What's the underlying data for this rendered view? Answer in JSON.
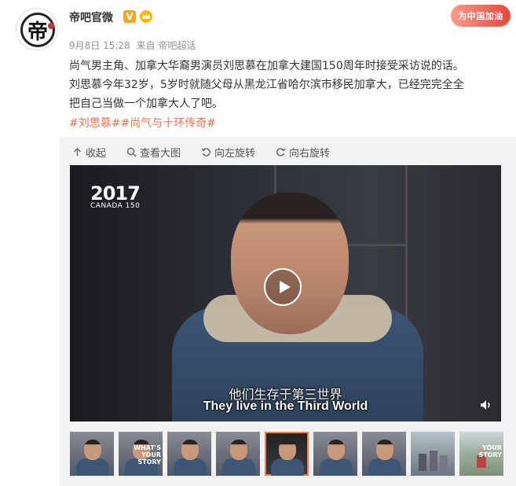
{
  "post": {
    "username": "帝吧官微",
    "avatar_char": "帝",
    "verified_badge": "V",
    "timestamp": "9月8日 15:28",
    "source_prefix": "来自",
    "source": "帝吧超话",
    "promo_badge": "为中国加油",
    "content_line1": "尚气男主角、加拿大华裔男演员刘思慕在加拿大建国150周年时接受采访说的话。",
    "content_line2": "刘思慕今年32岁，5岁时就随父母从黑龙江省哈尔滨市移民加拿大，已经完完全全",
    "content_line3": "把自己当做一个加拿大人了吧。",
    "tags": [
      "#刘思慕#",
      "#尚气与十环传奇#"
    ]
  },
  "toolbar": {
    "collapse": "收起",
    "view_large": "查看大图",
    "rotate_left": "向左旋转",
    "rotate_right": "向右旋转"
  },
  "video": {
    "logo_year": "2017",
    "logo_sub": "CANADA 150",
    "subtitle_cn": "他们生存于第三世界",
    "subtitle_en": "They live in the Third World"
  },
  "thumbnails": [
    {
      "kind": "person",
      "text": ""
    },
    {
      "kind": "person",
      "text": ""
    },
    {
      "kind": "person",
      "text": ""
    },
    {
      "kind": "person",
      "text": ""
    },
    {
      "kind": "person-active",
      "text": ""
    },
    {
      "kind": "person",
      "text": ""
    },
    {
      "kind": "person",
      "text": ""
    },
    {
      "kind": "person",
      "text": ""
    },
    {
      "kind": "scene",
      "text": ""
    },
    {
      "kind": "field",
      "text": "YOUR STORY"
    }
  ],
  "thumbnail_texts": [
    "WHAT'S YOUR STORY",
    "YOUR STORY"
  ],
  "colors": {
    "tag": "#eb7350",
    "active_thumb_border": "#f77e44",
    "verified": "#f5a623"
  },
  "icons": [
    "collapse-arrow-icon",
    "magnifier-icon",
    "rotate-left-icon",
    "rotate-right-icon",
    "play-icon",
    "volume-icon"
  ]
}
